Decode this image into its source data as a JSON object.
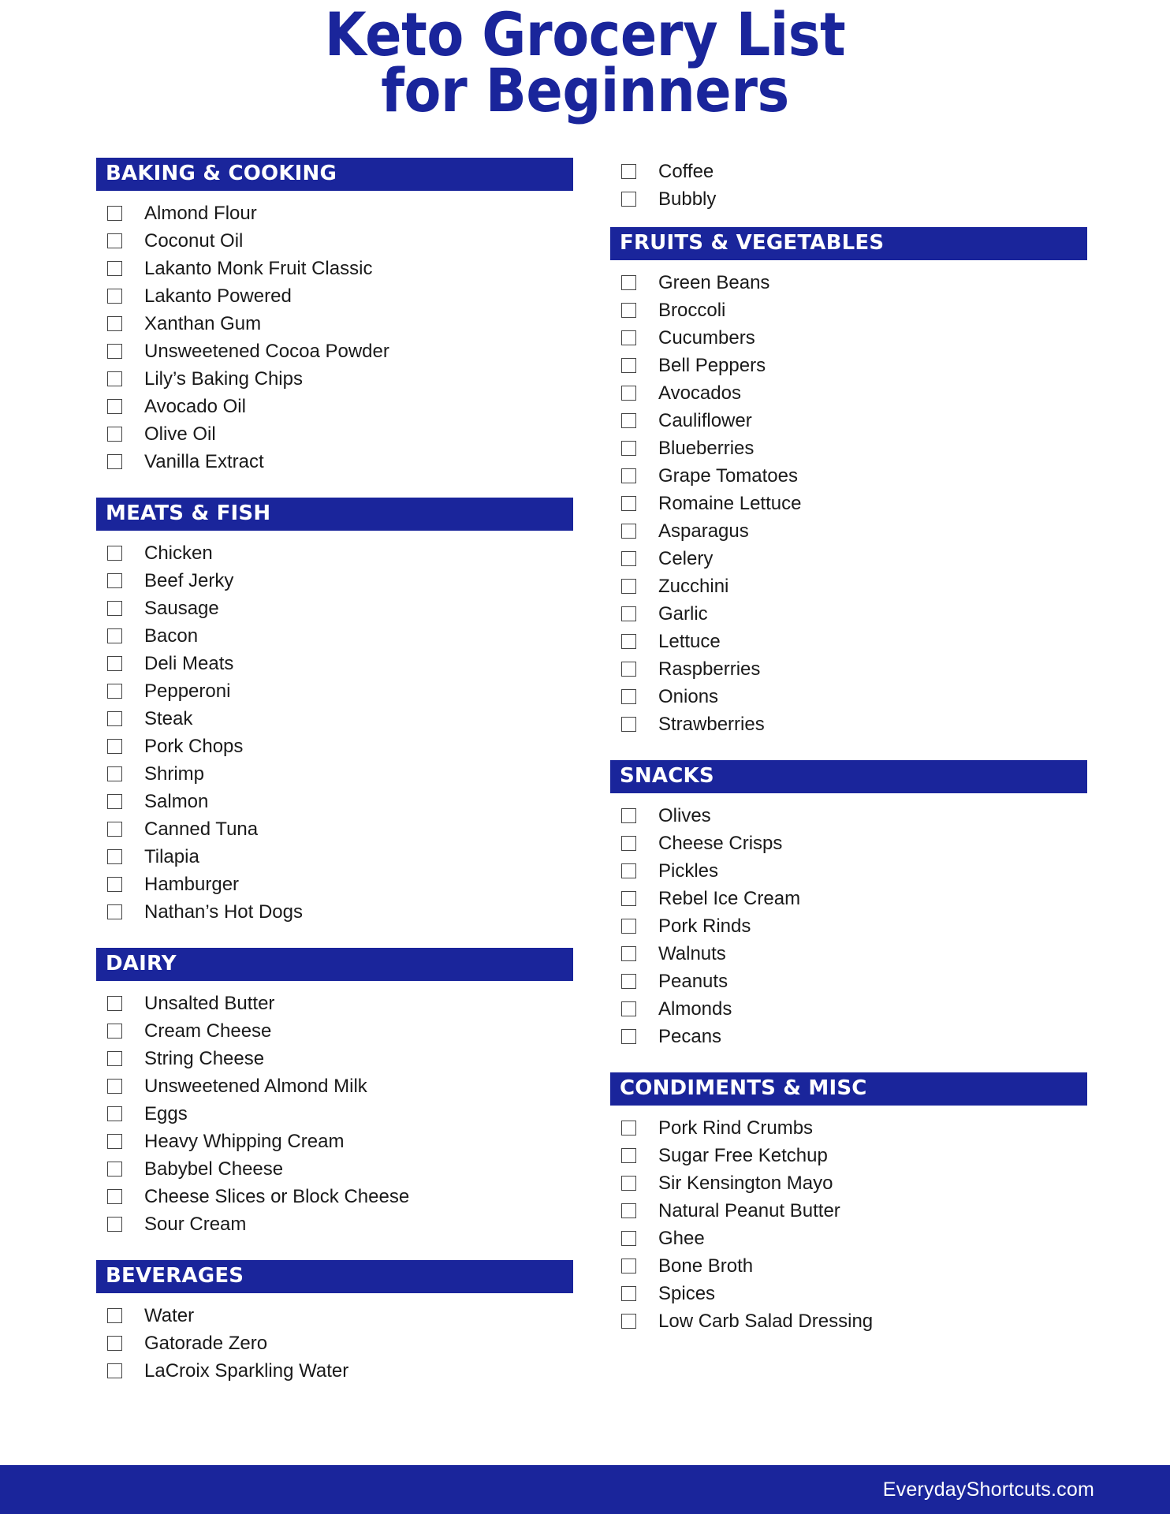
{
  "title": {
    "line1": "Keto Grocery List",
    "line2": "for Beginners"
  },
  "colors": {
    "brand_blue": "#1a259b",
    "header_text": "#ffffff",
    "item_text": "#1a1a1a",
    "checkbox_border": "#444444",
    "page_background": "#ffffff"
  },
  "icons": {
    "checkbox": "empty-checkbox"
  },
  "left_column": {
    "sections": [
      {
        "header": "BAKING & COOKING",
        "items": [
          "Almond Flour",
          "Coconut Oil",
          "Lakanto Monk Fruit Classic",
          "Lakanto Powered",
          "Xanthan Gum",
          "Unsweetened Cocoa Powder",
          "Lily’s Baking Chips",
          "Avocado Oil",
          "Olive Oil",
          "Vanilla Extract"
        ]
      },
      {
        "header": "MEATS & FISH",
        "items": [
          "Chicken",
          "Beef Jerky",
          "Sausage",
          "Bacon",
          "Deli Meats",
          "Pepperoni",
          "Steak",
          "Pork Chops",
          "Shrimp",
          "Salmon",
          "Canned Tuna",
          "Tilapia",
          "Hamburger",
          "Nathan’s Hot Dogs"
        ]
      },
      {
        "header": "DAIRY",
        "items": [
          "Unsalted Butter",
          "Cream Cheese",
          "String Cheese",
          "Unsweetened Almond Milk",
          "Eggs",
          "Heavy Whipping Cream",
          "Babybel Cheese",
          "Cheese Slices or Block Cheese",
          "Sour Cream"
        ]
      },
      {
        "header": "BEVERAGES",
        "items": [
          "Water",
          "Gatorade Zero",
          "LaCroix Sparkling Water"
        ]
      }
    ]
  },
  "right_column": {
    "continued_items": [
      "Coffee",
      "Bubbly"
    ],
    "sections": [
      {
        "header": "FRUITS & VEGETABLES",
        "items": [
          "Green Beans",
          "Broccoli",
          "Cucumbers",
          "Bell Peppers",
          "Avocados",
          "Cauliflower",
          "Blueberries",
          "Grape Tomatoes",
          "Romaine Lettuce",
          "Asparagus",
          "Celery",
          "Zucchini",
          "Garlic",
          "Lettuce",
          "Raspberries",
          "Onions",
          "Strawberries"
        ]
      },
      {
        "header": "SNACKS",
        "items": [
          "Olives",
          "Cheese Crisps",
          "Pickles",
          "Rebel Ice Cream",
          "Pork Rinds",
          "Walnuts",
          "Peanuts",
          "Almonds",
          "Pecans"
        ]
      },
      {
        "header": "CONDIMENTS & MISC",
        "items": [
          "Pork Rind Crumbs",
          "Sugar Free Ketchup",
          "Sir Kensington Mayo",
          "Natural Peanut Butter",
          "Ghee",
          "Bone Broth",
          "Spices",
          "Low Carb Salad Dressing"
        ]
      }
    ]
  },
  "footer": {
    "site": "EverydayShortcuts.com"
  }
}
